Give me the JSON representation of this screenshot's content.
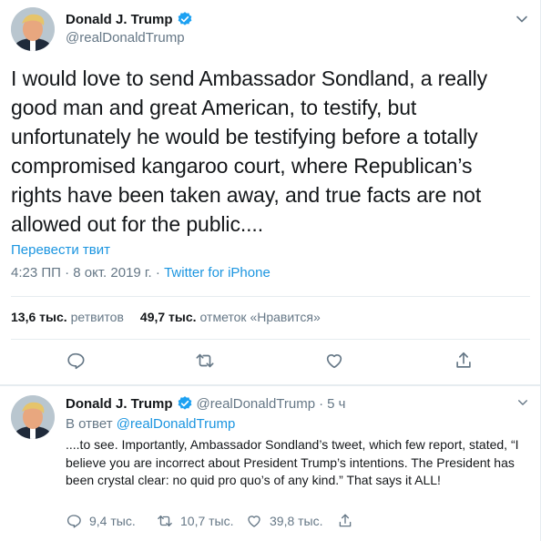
{
  "main_tweet": {
    "display_name": "Donald J. Trump",
    "handle": "@realDonaldTrump",
    "text": "I would love to send Ambassador Sondland, a really good man and great American, to testify, but unfortunately he would be testifying before a totally compromised kangaroo court, where Republican’s rights have been taken away, and true facts are not allowed out for the public....",
    "translate_label": "Перевести твит",
    "time_date": "4:23 ПП · 8 окт. 2019 г. · ",
    "source": "Twitter for iPhone",
    "retweets_count": "13,6 тыс.",
    "retweets_label": "ретвитов",
    "likes_count": "49,7 тыс.",
    "likes_label": "отметок «Нравится»"
  },
  "reply_tweet": {
    "display_name": "Donald J. Trump",
    "handle": "@realDonaldTrump",
    "separator": "·",
    "age": "5 ч",
    "reply_to_label": "В ответ",
    "reply_to_handle": "@realDonaldTrump",
    "text": "....to see. Importantly, Ambassador Sondland’s tweet, which few report, stated, “I believe you are incorrect about President Trump’s intentions. The President has been crystal clear: no quid pro quo’s of any kind.” That says it ALL!",
    "replies_count": "9,4 тыс.",
    "retweets_count": "10,7 тыс.",
    "likes_count": "39,8 тыс."
  },
  "colors": {
    "link": "#1b95e0",
    "secondary_text": "#657786",
    "divider": "#e6ecf0",
    "verified": "#1da1f2"
  },
  "icons": [
    "caret-down-icon",
    "verified-badge-icon",
    "reply-icon",
    "retweet-icon",
    "like-icon",
    "share-icon"
  ]
}
